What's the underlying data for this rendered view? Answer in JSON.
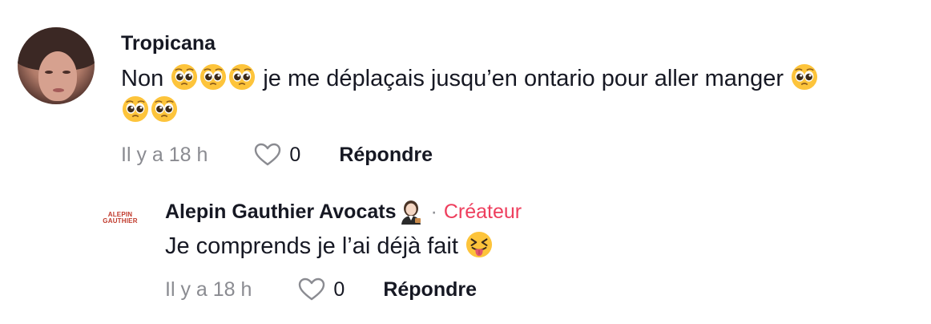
{
  "comment": {
    "username": "Tropicana",
    "text_start": "Non",
    "text_middle": "je me déplaçais jusqu’en ontario pour aller manger",
    "time": "Il y a 18 h",
    "likes": "0",
    "reply_label": "Répondre"
  },
  "reply": {
    "avatar_text_line1": "ALEPIN",
    "avatar_text_line2": "GAUTHIER",
    "username": "Alepin Gauthier Avocats",
    "separator": "·",
    "badge": "Créateur",
    "text": "Je comprends je l’ai déjà fait",
    "time": "Il y a 18 h",
    "likes": "0",
    "reply_label": "Répondre"
  },
  "colors": {
    "text": "#161823",
    "muted": "#8a8b91",
    "creator_badge": "#ee3e5d"
  },
  "icons": {
    "pleading_emoji": "pleading-face-emoji",
    "tongue_emoji": "squinting-tongue-emoji",
    "lawyer_emoji": "woman-judge-emoji",
    "heart": "heart-outline-icon"
  }
}
